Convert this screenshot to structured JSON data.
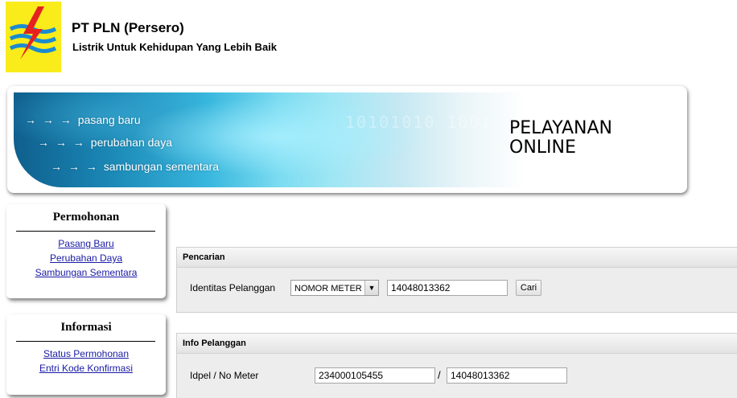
{
  "header": {
    "org_name": "PT PLN (Persero)",
    "tagline": "Listrik Untuk Kehidupan Yang Lebih Baik"
  },
  "banner": {
    "links": [
      "pasang baru",
      "perubahan daya",
      "sambungan sementara"
    ],
    "arrows": "→ → →",
    "title_line1": "PELAYANAN",
    "title_line2": "ONLINE",
    "binary": "10101010 1001"
  },
  "sidebar": {
    "permohonan": {
      "title": "Permohonan",
      "links": [
        "Pasang Baru",
        "Perubahan Daya",
        "Sambungan Sementara"
      ]
    },
    "informasi": {
      "title": "Informasi",
      "links": [
        "Status Permohonan",
        "Entri Kode Konfirmasi"
      ]
    }
  },
  "search": {
    "heading": "Pencarian",
    "label": "Identitas Pelanggan",
    "select_value": "NOMOR METER",
    "input_value": "14048013362",
    "button_label": "Cari"
  },
  "info": {
    "heading": "Info Pelanggan",
    "label": "Idpel / No Meter",
    "idpel_value": "234000105455",
    "separator": "/",
    "meter_value": "14048013362"
  },
  "colors": {
    "logo_bg": "#f9ec1a",
    "logo_red": "#e52220",
    "logo_blue": "#1a8bd0",
    "link": "#1a1aa6"
  }
}
